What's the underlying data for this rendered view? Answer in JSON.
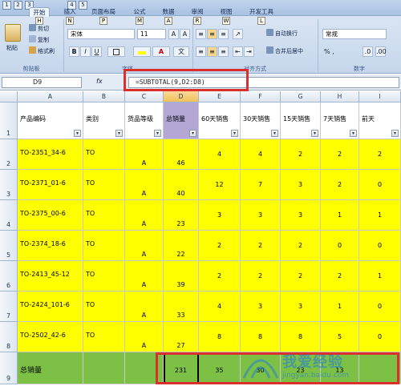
{
  "quick_access": [
    "1",
    "2",
    "3",
    "4",
    "5"
  ],
  "tabs": [
    {
      "label": "开始",
      "key": "H"
    },
    {
      "label": "插入",
      "key": "N"
    },
    {
      "label": "页面布局",
      "key": "P"
    },
    {
      "label": "公式",
      "key": "M"
    },
    {
      "label": "数据",
      "key": "A"
    },
    {
      "label": "审阅",
      "key": "R"
    },
    {
      "label": "视图",
      "key": "W"
    },
    {
      "label": "开发工具",
      "key": "L"
    }
  ],
  "ribbon": {
    "paste_label": "粘贴",
    "cut_label": "剪切",
    "copy_label": "复制",
    "format_painter_label": "格式刷",
    "clipboard_group": "剪贴板",
    "font_name": "宋体",
    "font_size": "11",
    "bold": "B",
    "italic": "I",
    "underline": "U",
    "font_group": "字体",
    "wrap_label": "自动换行",
    "merge_label": "合并后居中",
    "align_group": "对齐方式",
    "number_format": "常规",
    "number_group": "数字",
    "currency": "% ,"
  },
  "formula_bar": {
    "name_box": "D9",
    "fx": "fx",
    "formula": "=SUBTOTAL(9,D2:D8)"
  },
  "columns": [
    "A",
    "B",
    "C",
    "D",
    "E",
    "F",
    "G",
    "H",
    "I"
  ],
  "headers": [
    "产品编码",
    "类别",
    "货品等级",
    "总销量",
    "60天销售",
    "30天销售",
    "15天销售",
    "7天销售",
    "前天"
  ],
  "rows": [
    {
      "row": "2",
      "code": "TO-2351_34-6",
      "cat": "TO",
      "grade": "A",
      "total": "46",
      "d60": "4",
      "d30": "4",
      "d15": "2",
      "d7": "2",
      "prev": "2"
    },
    {
      "row": "3",
      "code": "TO-2371_01-6",
      "cat": "TO",
      "grade": "A",
      "total": "40",
      "d60": "12",
      "d30": "7",
      "d15": "3",
      "d7": "2",
      "prev": "0"
    },
    {
      "row": "4",
      "code": "TO-2375_00-6",
      "cat": "TO",
      "grade": "A",
      "total": "23",
      "d60": "3",
      "d30": "3",
      "d15": "3",
      "d7": "1",
      "prev": "1"
    },
    {
      "row": "5",
      "code": "TO-2374_18-6",
      "cat": "TO",
      "grade": "A",
      "total": "22",
      "d60": "2",
      "d30": "2",
      "d15": "2",
      "d7": "0",
      "prev": "0"
    },
    {
      "row": "6",
      "code": "TO-2413_45-12",
      "cat": "TO",
      "grade": "A",
      "total": "39",
      "d60": "2",
      "d30": "2",
      "d15": "2",
      "d7": "2",
      "prev": "1"
    },
    {
      "row": "7",
      "code": "TO-2424_101-6",
      "cat": "TO",
      "grade": "A",
      "total": "33",
      "d60": "4",
      "d30": "3",
      "d15": "3",
      "d7": "1",
      "prev": "0"
    },
    {
      "row": "8",
      "code": "TO-2502_42-6",
      "cat": "TO",
      "grade": "A",
      "total": "27",
      "d60": "8",
      "d30": "8",
      "d15": "8",
      "d7": "5",
      "prev": "0"
    }
  ],
  "total_row": {
    "row": "9",
    "label": "总销量",
    "total": "231",
    "d60": "35",
    "d30": "30",
    "d15": "23",
    "d7": "13"
  },
  "header_row": "1",
  "watermark": {
    "line1": "我爱经验",
    "line2": "jingyan.baidu.com"
  }
}
